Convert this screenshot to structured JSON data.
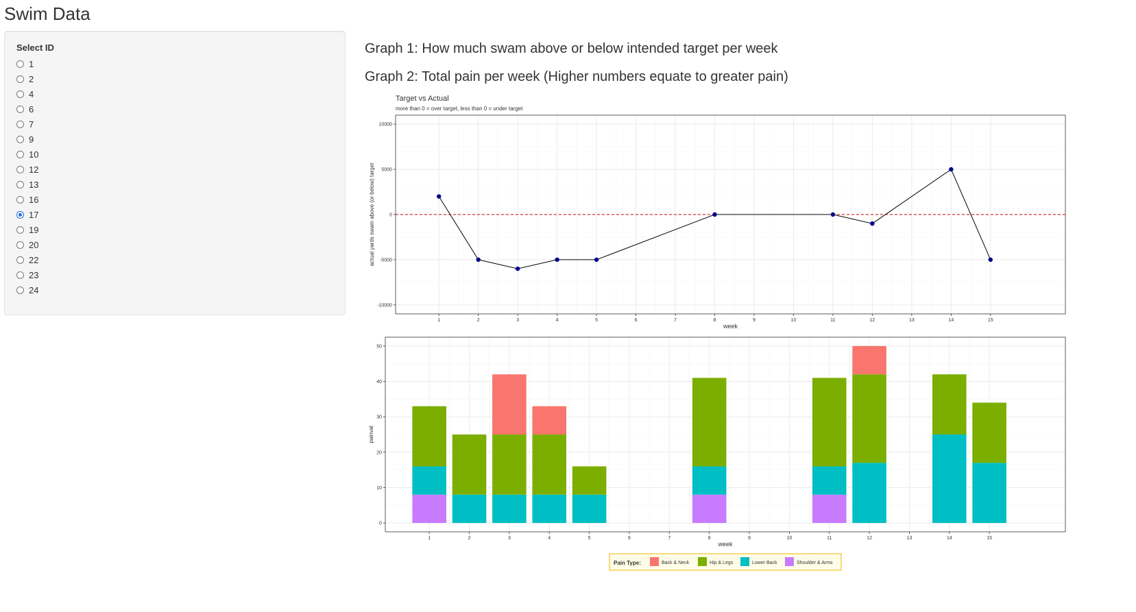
{
  "app": {
    "title": "Swim Data"
  },
  "sidebar": {
    "label": "Select ID",
    "options": [
      "1",
      "2",
      "4",
      "6",
      "7",
      "9",
      "10",
      "12",
      "13",
      "16",
      "17",
      "19",
      "20",
      "22",
      "23",
      "24"
    ],
    "selected": "17"
  },
  "main": {
    "heading1": "Graph 1: How much swam above or below intended target per week",
    "heading2": "Graph 2: Total pain per week (Higher numbers equate to greater pain)"
  },
  "chart_data": [
    {
      "type": "line",
      "title": "Target vs Actual",
      "subtitle": "more than 0 = over target, less than 0 = under target",
      "xlabel": "week",
      "ylabel": "actual yards swam above (or below) target",
      "x_ticks": [
        1,
        2,
        3,
        4,
        5,
        6,
        7,
        8,
        9,
        10,
        11,
        12,
        13,
        14,
        15
      ],
      "y_ticks": [
        10000,
        5000,
        0,
        -5000,
        -10000
      ],
      "xlim": [
        -0.1,
        16.9
      ],
      "ylim": [
        -11000,
        11000
      ],
      "x": [
        1,
        2,
        3,
        4,
        5,
        8,
        11,
        12,
        14,
        15
      ],
      "values": [
        2000,
        -5000,
        -6000,
        -5000,
        -5000,
        0,
        0,
        -1000,
        5000,
        -5000
      ],
      "reference_line": {
        "y": 0,
        "style": "dashed",
        "color": "#cc0000"
      },
      "line_color": "#000000",
      "point_color": "#00008b",
      "grid": true,
      "legend": "none"
    },
    {
      "type": "bar",
      "stacked": true,
      "xlabel": "week",
      "ylabel": "painval",
      "x_ticks": [
        1,
        2,
        3,
        4,
        5,
        6,
        7,
        8,
        9,
        10,
        11,
        12,
        13,
        14,
        15
      ],
      "y_ticks": [
        0,
        10,
        20,
        30,
        40,
        50
      ],
      "xlim": [
        -0.1,
        16.9
      ],
      "ylim": [
        -2.5,
        52.5
      ],
      "categories": [
        1,
        2,
        3,
        4,
        5,
        8,
        11,
        12,
        14,
        15
      ],
      "series": [
        {
          "name": "Shoulder & Arms",
          "color": "#c77cff",
          "values": [
            8,
            0,
            0,
            0,
            0,
            8,
            8,
            0,
            0,
            0
          ]
        },
        {
          "name": "Lower Back",
          "color": "#00bfc4",
          "values": [
            8,
            8,
            8,
            8,
            8,
            8,
            8,
            17,
            25,
            17
          ]
        },
        {
          "name": "Hip & Legs",
          "color": "#7cae00",
          "values": [
            17,
            17,
            17,
            17,
            8,
            25,
            25,
            25,
            17,
            17
          ]
        },
        {
          "name": "Back & Neck",
          "color": "#f8766d",
          "values": [
            0,
            0,
            17,
            8,
            0,
            0,
            0,
            8,
            0,
            0
          ]
        }
      ],
      "legend_title": "Pain Type:",
      "legend_order": [
        "Back & Neck",
        "Hip & Legs",
        "Lower Back",
        "Shoulder & Arms"
      ],
      "legend": "bottom",
      "grid": true
    }
  ]
}
